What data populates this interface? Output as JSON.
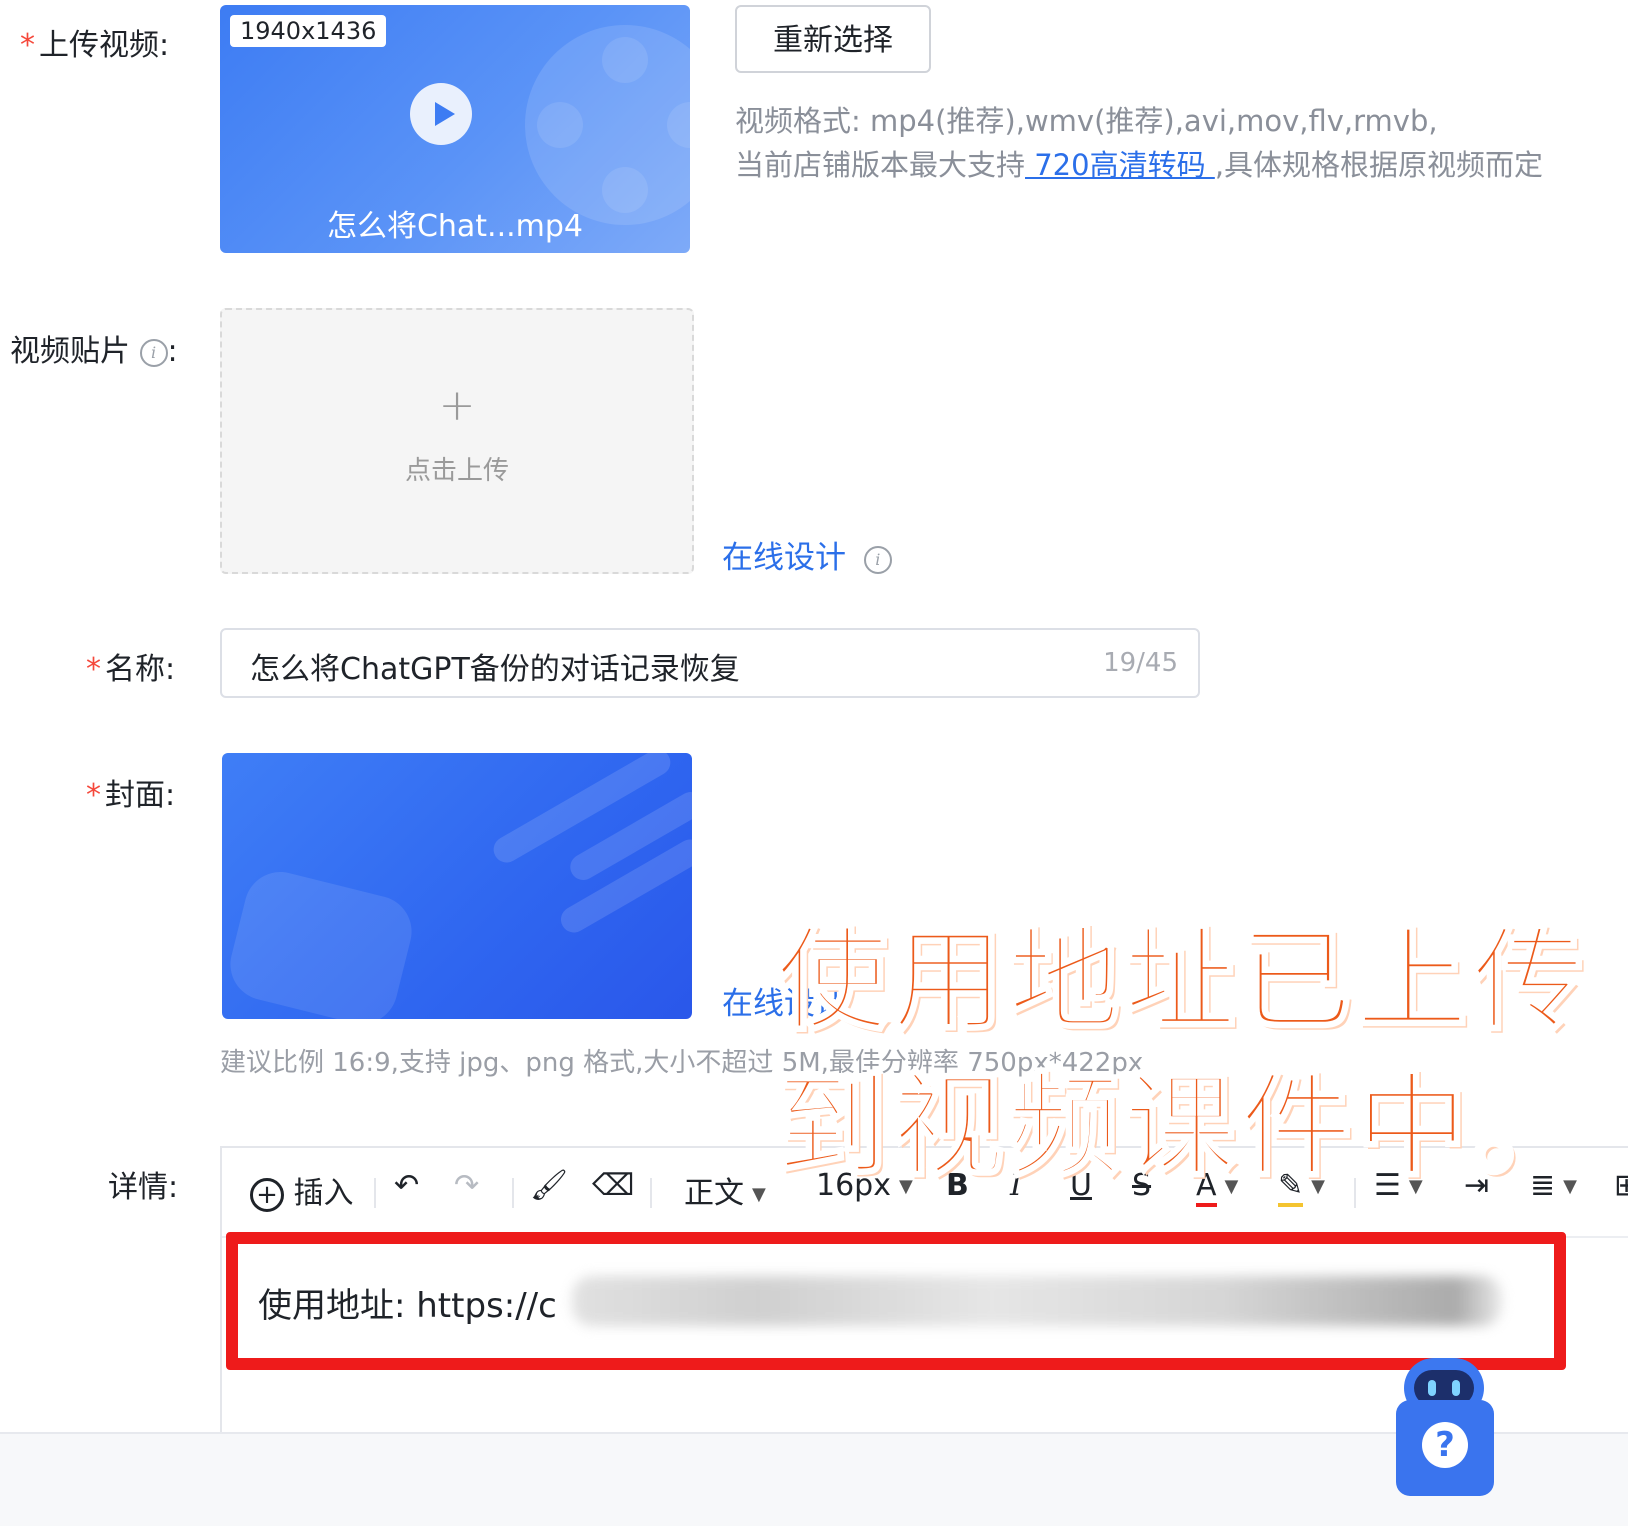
{
  "form": {
    "upload_video_label": "上传视频:",
    "video_sticker_label": "视频贴片",
    "name_label": "名称:",
    "cover_label": "封面:",
    "details_label": "详情:",
    "colon": ":"
  },
  "video": {
    "resolution": "1940x1436",
    "file_name": "怎么将Chat...mp4",
    "reselect_label": "重新选择",
    "hint_line1": "视频格式: mp4(推荐),wmv(推荐),avi,mov,flv,rmvb,",
    "hint_line2_prefix": "当前店铺版本最大支持",
    "hint_link": " 720高清转码 ",
    "hint_line2_suffix": ",具体规格根据原视频而定"
  },
  "sticker": {
    "plus": "+",
    "upload_text": "点击上传",
    "design_link": "在线设计"
  },
  "name": {
    "value": "怎么将ChatGPT备份的对话记录恢复",
    "count": "19/45"
  },
  "cover": {
    "design_link": "在线设计",
    "hint": "建议比例 16:9,支持 jpg、png 格式,大小不超过 5M,最佳分辨率 750px*422px"
  },
  "editor": {
    "insert_label": "插入",
    "paragraph_label": "正文",
    "font_size": "16px",
    "bold": "B",
    "italic": "I",
    "underline": "U",
    "strike": "S",
    "font_color": "A",
    "content_prefix": "使用地址: https://c"
  },
  "annotation": {
    "line1": "使用地址已上传",
    "line2": "到视频课件中。"
  },
  "help": {
    "symbol": "?"
  },
  "colors": {
    "accent": "#2b6fe9",
    "required_star": "#f5483b",
    "highlight_box": "#ee1b1b",
    "annotation_text": "#ec5a1a"
  }
}
